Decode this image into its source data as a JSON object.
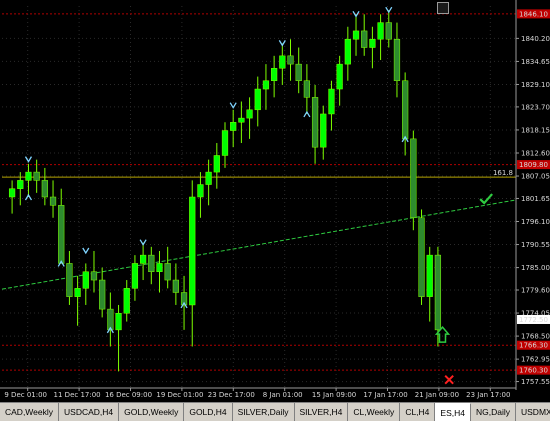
{
  "chart": {
    "y_axis": {
      "min": 1756.0,
      "max": 1848.0,
      "tick_values": [
        "1840.20",
        "1834.65",
        "1829.10",
        "1823.70",
        "1818.15",
        "1812.60",
        "1807.05",
        "1801.65",
        "1796.10",
        "1790.55",
        "1785.00",
        "1779.60",
        "1774.05",
        "1768.50",
        "1762.95",
        "1757.55"
      ],
      "badges": [
        {
          "label": "1846.10",
          "value": 1846.1,
          "color": "#c00000"
        },
        {
          "label": "1809.80",
          "value": 1809.8,
          "color": "#c00000"
        },
        {
          "label": "1772.50",
          "value": 1772.5,
          "color": "#ffffff"
        },
        {
          "label": "1766.30",
          "value": 1766.3,
          "color": "#c00000"
        },
        {
          "label": "1760.30",
          "value": 1760.3,
          "color": "#c00000"
        }
      ]
    },
    "time_labels": [
      "9 Dec 01:00",
      "11 Dec 17:00",
      "16 Dec 09:00",
      "19 Dec 01:00",
      "23 Dec 17:00",
      "8 Jan 01:00",
      "15 Jan 09:00",
      "17 Jan 17:00",
      "21 Jan 09:00",
      "23 Jan 17:00"
    ],
    "fib_line": {
      "value": 1806.8,
      "label": "161.8",
      "color": "#b5a400"
    },
    "red_dashed_levels": [
      1846.1,
      1809.8,
      1766.3,
      1760.3
    ],
    "trendline": {
      "start": [
        0,
        1779.8
      ],
      "end": [
        1,
        1801.3
      ],
      "color": "#2ecc40"
    },
    "candles": [
      [
        1802,
        1806,
        1798,
        1804
      ],
      [
        1804,
        1808,
        1800,
        1806
      ],
      [
        1806,
        1810,
        1802,
        1808
      ],
      [
        1808,
        1811,
        1803,
        1806
      ],
      [
        1806,
        1809,
        1800,
        1802
      ],
      [
        1802,
        1806,
        1797,
        1800
      ],
      [
        1800,
        1804,
        1790,
        1786
      ],
      [
        1786,
        1789,
        1776,
        1778
      ],
      [
        1778,
        1783,
        1771,
        1780
      ],
      [
        1780,
        1786,
        1776,
        1784
      ],
      [
        1784,
        1789,
        1779,
        1782
      ],
      [
        1782,
        1785,
        1773,
        1775
      ],
      [
        1775,
        1779,
        1766,
        1770
      ],
      [
        1770,
        1776,
        1760,
        1774
      ],
      [
        1774,
        1782,
        1772,
        1780
      ],
      [
        1780,
        1788,
        1777,
        1786
      ],
      [
        1786,
        1791,
        1782,
        1788
      ],
      [
        1788,
        1790,
        1781,
        1784
      ],
      [
        1784,
        1789,
        1779,
        1786
      ],
      [
        1786,
        1790,
        1780,
        1782
      ],
      [
        1782,
        1786,
        1776,
        1779
      ],
      [
        1779,
        1783,
        1770,
        1776
      ],
      [
        1776,
        1806,
        1766,
        1802
      ],
      [
        1802,
        1808,
        1797,
        1805
      ],
      [
        1805,
        1811,
        1800,
        1808
      ],
      [
        1808,
        1815,
        1804,
        1812
      ],
      [
        1812,
        1820,
        1809,
        1818
      ],
      [
        1818,
        1823,
        1814,
        1820
      ],
      [
        1820,
        1825,
        1815,
        1821
      ],
      [
        1821,
        1826,
        1816,
        1823
      ],
      [
        1823,
        1831,
        1819,
        1828
      ],
      [
        1828,
        1834,
        1823,
        1830
      ],
      [
        1830,
        1836,
        1826,
        1833
      ],
      [
        1833,
        1839,
        1829,
        1836
      ],
      [
        1836,
        1840,
        1830,
        1834
      ],
      [
        1834,
        1838,
        1827,
        1830
      ],
      [
        1830,
        1834,
        1822,
        1826
      ],
      [
        1826,
        1829,
        1810,
        1814
      ],
      [
        1814,
        1824,
        1811,
        1822
      ],
      [
        1822,
        1830,
        1818,
        1828
      ],
      [
        1828,
        1836,
        1824,
        1834
      ],
      [
        1834,
        1843,
        1830,
        1840
      ],
      [
        1840,
        1846,
        1836,
        1842
      ],
      [
        1842,
        1846,
        1836,
        1838
      ],
      [
        1838,
        1843,
        1833,
        1840
      ],
      [
        1840,
        1846,
        1835,
        1844
      ],
      [
        1844,
        1847,
        1838,
        1840
      ],
      [
        1840,
        1844,
        1826,
        1830
      ],
      [
        1830,
        1832,
        1812,
        1816
      ],
      [
        1816,
        1818,
        1794,
        1797
      ],
      [
        1797,
        1799,
        1776,
        1778
      ],
      [
        1778,
        1790,
        1772,
        1788
      ],
      [
        1788,
        1790,
        1766,
        1770
      ]
    ],
    "arrows_up": [
      [
        2,
        1802
      ],
      [
        6,
        1786
      ],
      [
        12,
        1770
      ],
      [
        21,
        1776
      ],
      [
        36,
        1822
      ],
      [
        48,
        1816
      ]
    ],
    "arrows_down": [
      [
        2,
        1811
      ],
      [
        9,
        1789
      ],
      [
        16,
        1791
      ],
      [
        27,
        1824
      ],
      [
        33,
        1839
      ],
      [
        42,
        1846
      ],
      [
        46,
        1847
      ]
    ],
    "check_mark": {
      "at": [
        0.94,
        1801.5
      ],
      "color": "#2ecc40"
    },
    "up_arrow_marker": {
      "at": [
        0.857,
        1768.5
      ],
      "color": "#2ecc40"
    },
    "x_marker": {
      "at": [
        0.87,
        1758.0
      ],
      "color": "#ff2020"
    }
  },
  "tabs": [
    {
      "label": "CAD,Weekly",
      "active": false
    },
    {
      "label": "USDCAD,H4",
      "active": false
    },
    {
      "label": "GOLD,Weekly",
      "active": false
    },
    {
      "label": "GOLD,H4",
      "active": false
    },
    {
      "label": "SILVER,Daily",
      "active": false
    },
    {
      "label": "SILVER,H4",
      "active": false
    },
    {
      "label": "CL,Weekly",
      "active": false
    },
    {
      "label": "CL,H4",
      "active": false
    },
    {
      "label": "ES,H4",
      "active": true
    },
    {
      "label": "NG,Daily",
      "active": false
    },
    {
      "label": "USDMXN,H",
      "active": false
    }
  ]
}
